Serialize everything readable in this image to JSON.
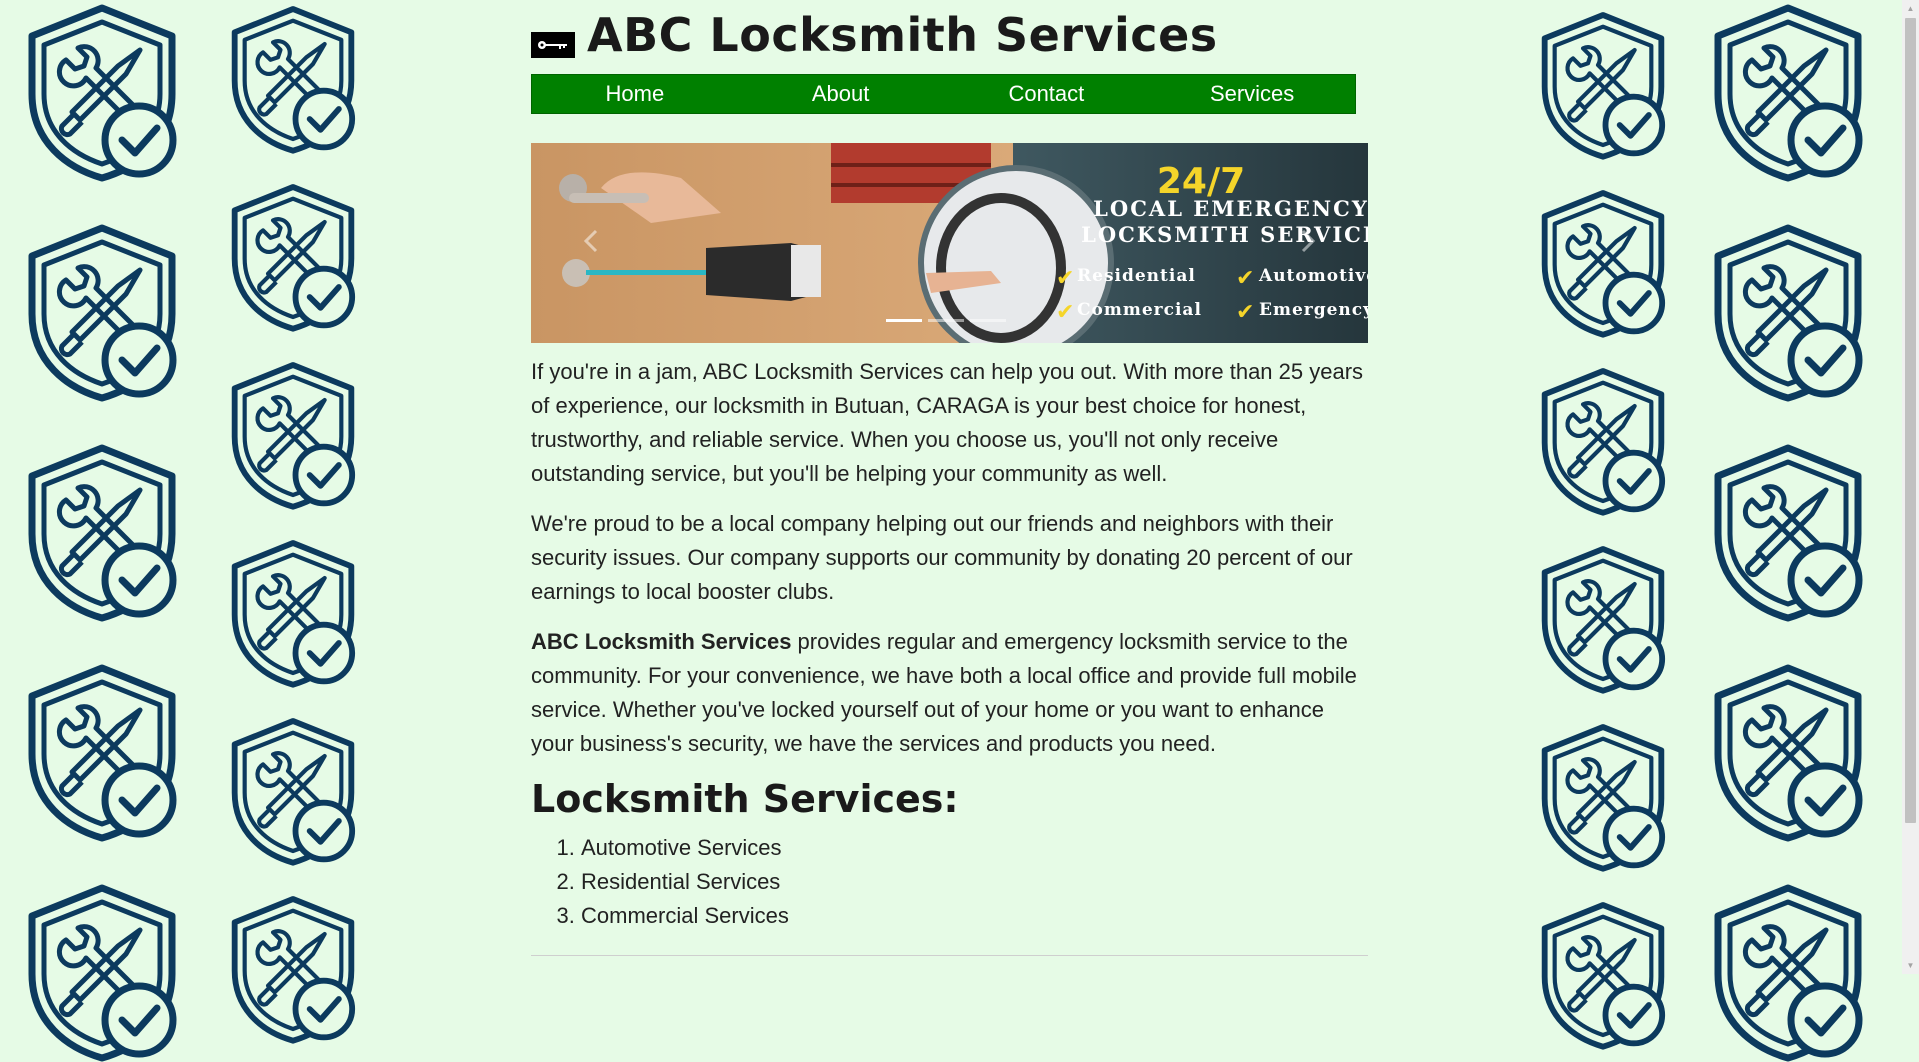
{
  "header": {
    "title": "ABC Locksmith Services",
    "logo_icon": "key-icon"
  },
  "nav": {
    "items": [
      {
        "label": "Home"
      },
      {
        "label": "About"
      },
      {
        "label": "Contact"
      },
      {
        "label": "Services"
      }
    ]
  },
  "banner": {
    "headline": "24/7",
    "line1": "LOCAL EMERGENCY",
    "line2": "LOCKSMITH SERVICE",
    "features": [
      "Residential",
      "Automotive",
      "Commercial",
      "Emergency"
    ],
    "headline_color": "#f5d52a"
  },
  "content": {
    "p1": "If you're in a jam, ABC Locksmith Services can help you out. With more than 25 years of experience, our locksmith in Butuan, CARAGA is your best choice for honest, trustworthy, and reliable service. When you choose us, you'll not only receive outstanding service, but you'll be helping your community as well.",
    "p2": "We're proud to be a local company helping out our friends and neighbors with their security issues. Our company supports our community by donating 20 percent of our earnings to local booster clubs.",
    "p3_bold": "ABC Locksmith Services",
    "p3_rest": " provides regular and emergency locksmith service to the community. For your convenience, we have both a local office and provide full mobile service. Whether you've locked yourself out of your home or you want to enhance your business's security, we have the services and products you need.",
    "services_heading": "Locksmith Services:",
    "services": [
      "Automotive Services",
      "Residential Services",
      "Commercial Services"
    ]
  },
  "colors": {
    "background": "#e6fbe6",
    "nav": "#008000",
    "icon": "#0c3a5e"
  },
  "decor": {
    "icon": "shield-tools-check-icon"
  }
}
